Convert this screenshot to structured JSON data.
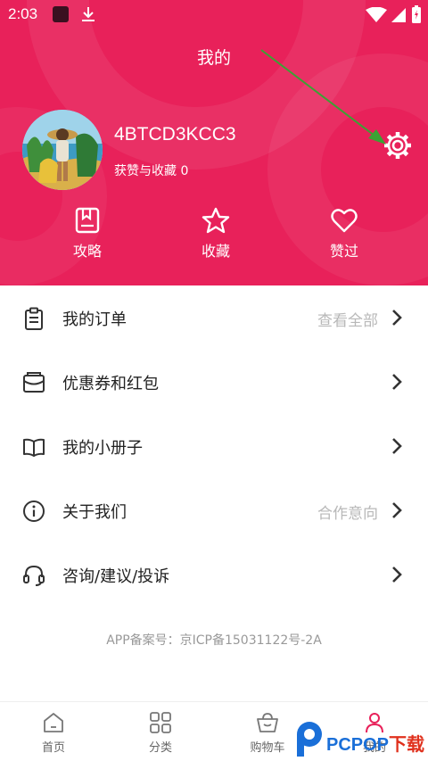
{
  "status_bar": {
    "time": "2:03"
  },
  "header": {
    "title": "我的",
    "username": "4BTCD3KCC3",
    "likes_label": "获赞与收藏 0"
  },
  "quick_actions": [
    {
      "label": "攻略",
      "icon": "guide-book-icon"
    },
    {
      "label": "收藏",
      "icon": "star-icon"
    },
    {
      "label": "赞过",
      "icon": "heart-icon"
    }
  ],
  "menu": [
    {
      "label": "我的订单",
      "extra": "查看全部",
      "icon": "order-clipboard-icon"
    },
    {
      "label": "优惠券和红包",
      "extra": "",
      "icon": "coupon-envelope-icon"
    },
    {
      "label": "我的小册子",
      "extra": "",
      "icon": "open-book-icon"
    },
    {
      "label": "关于我们",
      "extra": "合作意向",
      "icon": "info-icon"
    },
    {
      "label": "咨询/建议/投诉",
      "extra": "",
      "icon": "headset-icon"
    }
  ],
  "icp": "APP备案号：京ICP备15031122号-2A",
  "tabs": [
    {
      "label": "首页",
      "icon": "home-icon"
    },
    {
      "label": "分类",
      "icon": "grid-icon"
    },
    {
      "label": "购物车",
      "icon": "basket-icon"
    },
    {
      "label": "我的",
      "icon": "person-icon"
    }
  ],
  "watermark": {
    "latin": "PCPOP",
    "zh": "下载"
  },
  "colors": {
    "brand": "#e8215a",
    "annotation_arrow": "#3aa334",
    "watermark_blue": "#1a6fd8"
  }
}
